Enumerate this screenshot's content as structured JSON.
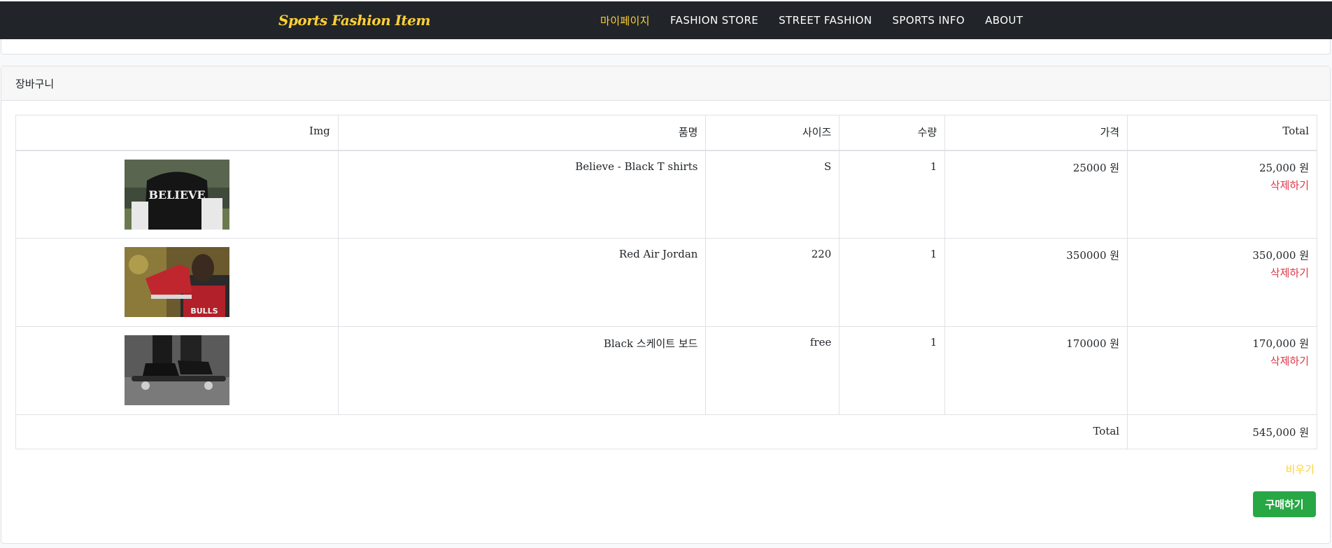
{
  "nav": {
    "brand": "Sports Fashion Item",
    "links": [
      "마이페이지",
      "FASHION STORE",
      "STREET FASHION",
      "SPORTS INFO",
      "ABOUT"
    ]
  },
  "cart": {
    "title": "장바구니",
    "headers": [
      "Img",
      "품명",
      "사이즈",
      "수량",
      "가격",
      "Total"
    ],
    "items": [
      {
        "name": "Believe - Black T shirts",
        "size": "S",
        "qty": "1",
        "price": "25000 원",
        "total": "25,000 원",
        "delete": "삭제하기",
        "image_text": "BELIEVE"
      },
      {
        "name": "Red Air Jordan",
        "size": "220",
        "qty": "1",
        "price": "350000 원",
        "total": "350,000 원",
        "delete": "삭제하기",
        "image_text": "BULLS"
      },
      {
        "name": "Black 스케이트 보드",
        "size": "free",
        "qty": "1",
        "price": "170000 원",
        "total": "170,000 원",
        "delete": "삭제하기"
      }
    ],
    "total_label": "Total",
    "total_value": "545,000 원",
    "clear": "비우기",
    "buy": "구매하기"
  },
  "colors": {
    "navbar": "#212529",
    "accent": "#fed136",
    "delete": "#dc3545",
    "buy": "#28a745"
  }
}
